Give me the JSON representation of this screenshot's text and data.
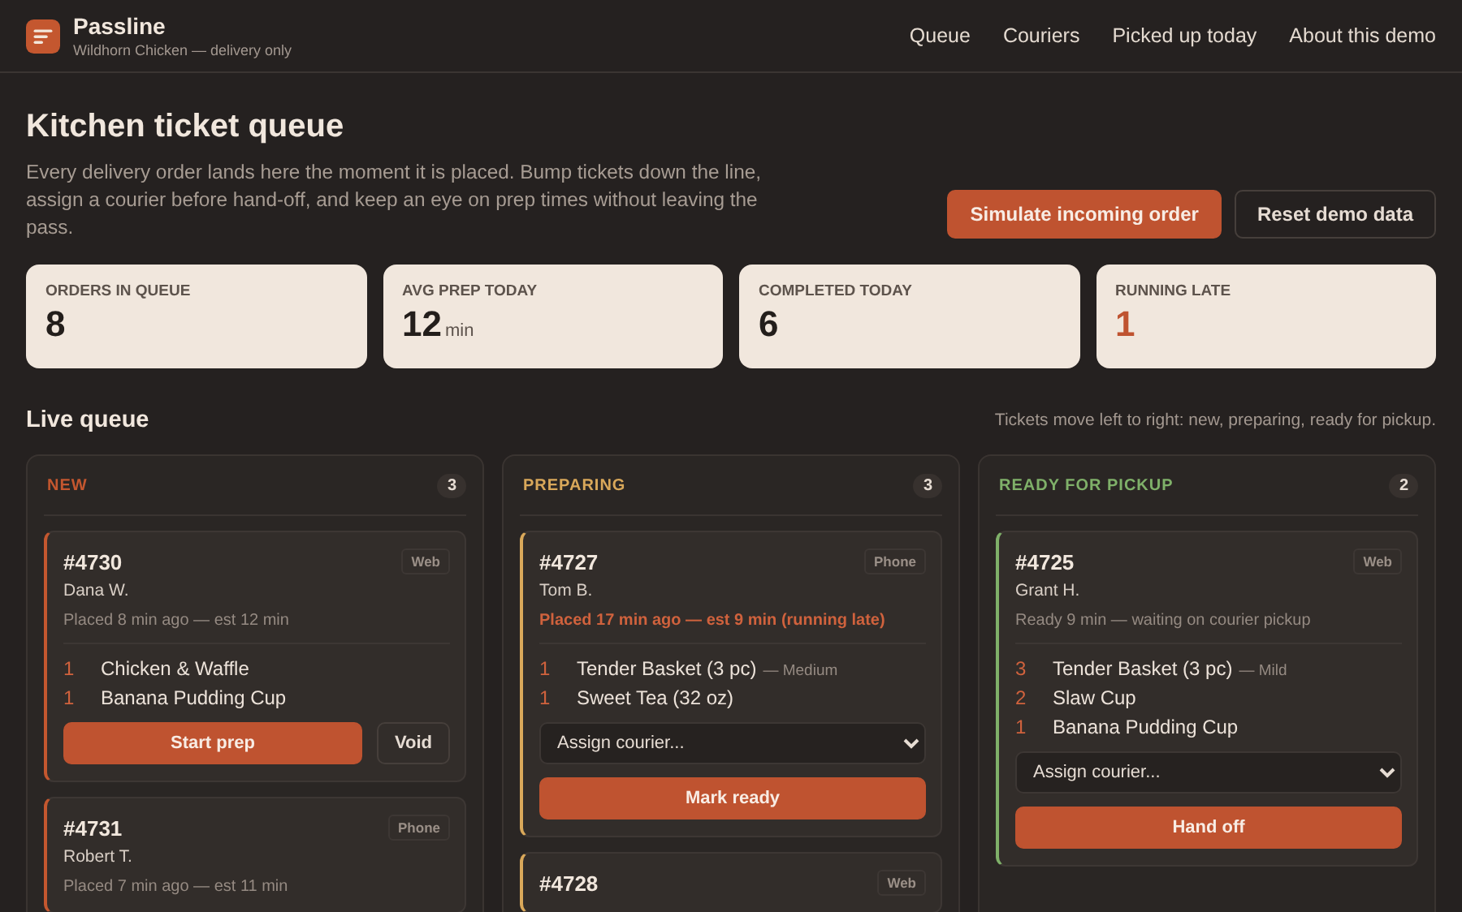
{
  "brand": {
    "name": "Passline",
    "subtitle": "Wildhorn Chicken — delivery only"
  },
  "nav": [
    "Queue",
    "Couriers",
    "Picked up today",
    "About this demo"
  ],
  "page": {
    "title": "Kitchen ticket queue",
    "description": "Every delivery order lands here the moment it is placed. Bump tickets down the line, assign a courier before hand-off, and keep an eye on prep times without leaving the pass.",
    "actions": [
      {
        "label": "Simulate incoming order",
        "kind": "primary"
      },
      {
        "label": "Reset demo data",
        "kind": "secondary"
      }
    ]
  },
  "stats": [
    {
      "label": "ORDERS IN QUEUE",
      "value": "8",
      "alert": false
    },
    {
      "label": "AVG PREP TODAY",
      "value": "12",
      "unit": "min",
      "alert": false
    },
    {
      "label": "COMPLETED TODAY",
      "value": "6",
      "alert": false
    },
    {
      "label": "RUNNING LATE",
      "value": "1",
      "alert": true
    }
  ],
  "queue": {
    "title": "Live queue",
    "hint": "Tickets move left to right: new, preparing, ready for pickup.",
    "columns": [
      {
        "title": "NEW",
        "count": "3",
        "color": "#c4572f",
        "tickets": [
          {
            "number": "#4730",
            "channel": "Web",
            "customer": "Dana W.",
            "status": "Placed 8 min ago — est 12 min",
            "late": false,
            "items": [
              {
                "qty": "1",
                "name": "Chicken & Waffle"
              },
              {
                "qty": "1",
                "name": "Banana Pudding Cup"
              }
            ],
            "actions": [
              {
                "label": "Start prep",
                "kind": "primary"
              },
              {
                "label": "Void",
                "kind": "secondary"
              }
            ]
          },
          {
            "number": "#4731",
            "channel": "Phone",
            "customer": "Robert T.",
            "status": "Placed 7 min ago — est 11 min",
            "late": false
          }
        ]
      },
      {
        "title": "PREPARING",
        "count": "3",
        "color": "#d9a85a",
        "tickets": [
          {
            "number": "#4727",
            "channel": "Phone",
            "customer": "Tom B.",
            "status": "Placed 17 min ago — est 9 min (running late)",
            "late": true,
            "items": [
              {
                "qty": "1",
                "name": "Tender Basket (3 pc)",
                "note": "— Medium"
              },
              {
                "qty": "1",
                "name": "Sweet Tea (32 oz)"
              }
            ],
            "courier_placeholder": "Assign courier...",
            "actions": [
              {
                "label": "Mark ready",
                "kind": "primary"
              }
            ]
          },
          {
            "number": "#4728",
            "channel": "Web"
          }
        ]
      },
      {
        "title": "READY FOR PICKUP",
        "count": "2",
        "color": "#7fb069",
        "tickets": [
          {
            "number": "#4725",
            "channel": "Web",
            "customer": "Grant H.",
            "status": "Ready 9 min — waiting on courier pickup",
            "late": false,
            "items": [
              {
                "qty": "3",
                "name": "Tender Basket (3 pc)",
                "note": "— Mild"
              },
              {
                "qty": "2",
                "name": "Slaw Cup"
              },
              {
                "qty": "1",
                "name": "Banana Pudding Cup"
              }
            ],
            "courier_placeholder": "Assign courier...",
            "actions": [
              {
                "label": "Hand off",
                "kind": "primary"
              }
            ]
          }
        ]
      }
    ]
  }
}
